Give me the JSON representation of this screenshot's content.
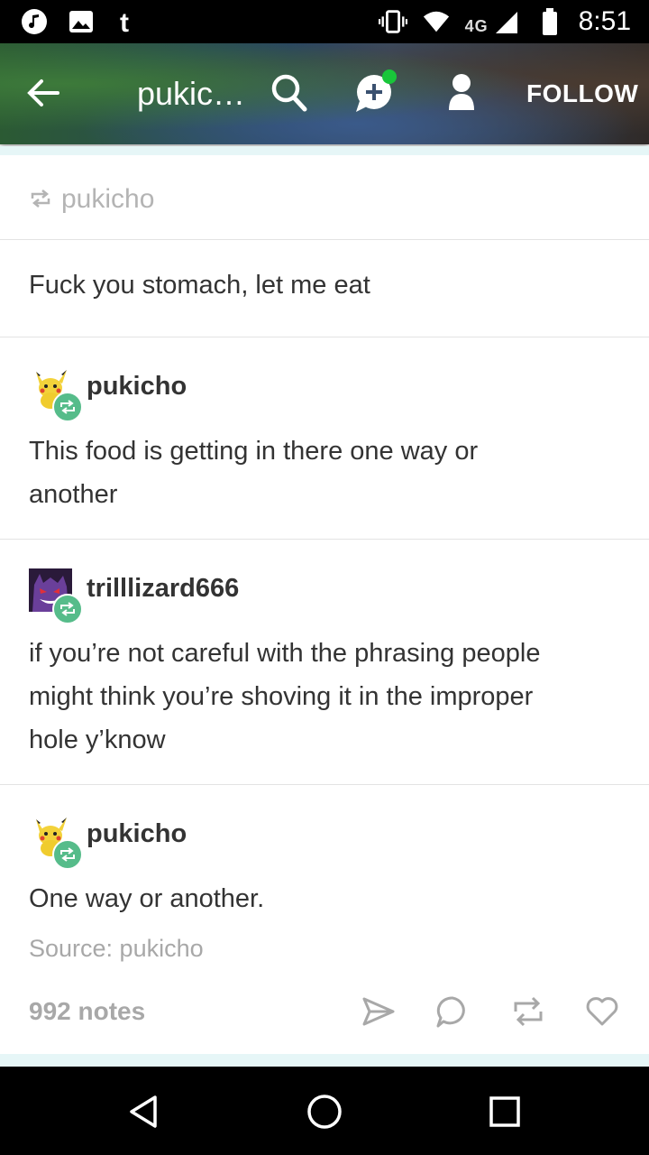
{
  "status_bar": {
    "time": "8:51",
    "network": "4G",
    "left_icons": [
      "music-icon",
      "image-icon",
      "tumblr-icon"
    ],
    "right_icons": [
      "vibrate-icon",
      "wifi-icon",
      "signal-icon",
      "battery-icon"
    ]
  },
  "app_bar": {
    "title": "pukic…",
    "follow_label": "FOLLOW",
    "icons": [
      "back-arrow-icon",
      "search-icon",
      "new-message-icon",
      "user-icon"
    ],
    "notification_color": "#19c63a"
  },
  "post": {
    "reblog_from": "pukicho",
    "original_text": "Fuck you stomach, let me eat",
    "replies": [
      {
        "username": "pukicho",
        "avatar": "pikachu",
        "text_lines": [
          "This food is getting in there one way or",
          "another"
        ]
      },
      {
        "username": "trilllizard666",
        "avatar": "gengar",
        "text_lines": [
          "if you’re not careful with the phrasing people",
          "might think you’re shoving it in the improper",
          "hole y’know"
        ]
      },
      {
        "username": "pukicho",
        "avatar": "pikachu",
        "text_lines": [
          "One way or another."
        ]
      }
    ],
    "source": "Source: pukicho",
    "notes": "992 notes",
    "actions": [
      "share-icon",
      "reply-icon",
      "reblog-icon",
      "like-icon"
    ]
  },
  "colors": {
    "reblog_badge": "#56bc8a",
    "accent_line": "#e6f6f7"
  },
  "nav_bar": {
    "buttons": [
      "back-triangle-icon",
      "home-circle-icon",
      "recents-square-icon"
    ]
  }
}
